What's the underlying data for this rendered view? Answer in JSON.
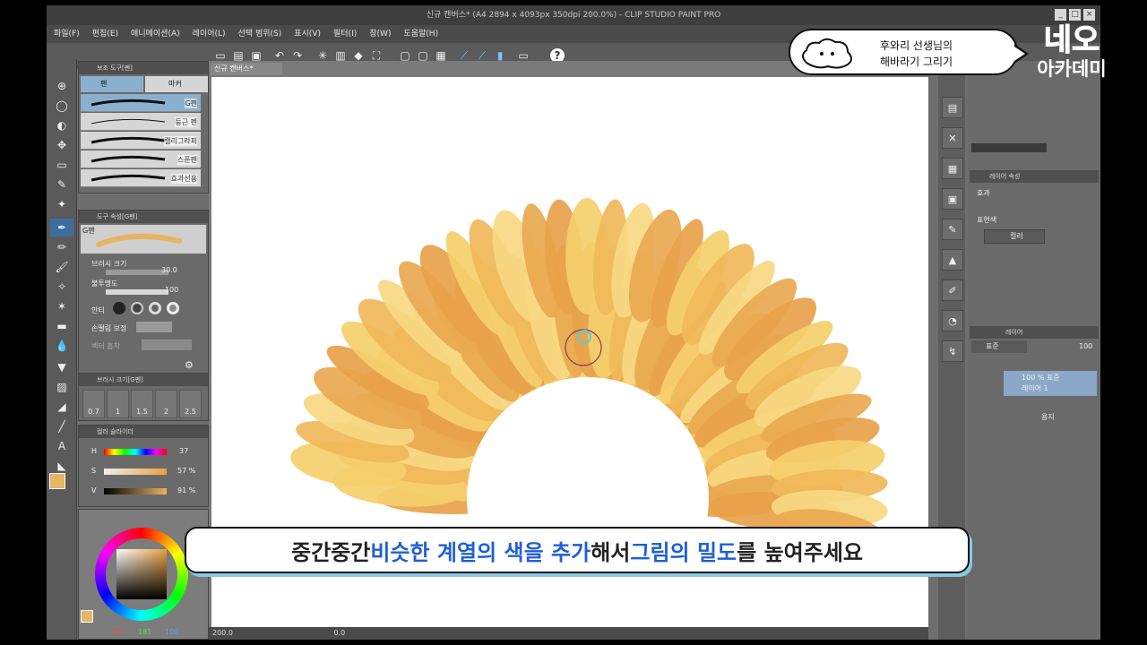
{
  "window": {
    "title": "신규 캔버스* (A4 2894 x 4093px 350dpi 200.0%) - CLIP STUDIO PAINT PRO",
    "controls": [
      "_",
      "□",
      "×"
    ]
  },
  "menu": {
    "items": [
      "파일(F)",
      "편집(E)",
      "애니메이션(A)",
      "레이어(L)",
      "선택 범위(S)",
      "표시(V)",
      "필터(I)",
      "창(W)",
      "도움말(H)"
    ]
  },
  "subtool_panel": {
    "title": "보조 도구[펜]",
    "tabs": [
      "펜",
      "마커"
    ],
    "brushes": [
      "G펜",
      "둥근 펜",
      "캘리그라피",
      "스푼펜",
      "효과선용"
    ]
  },
  "tool_property": {
    "title": "도구 속성[G펜]",
    "name": "G펜",
    "brush_size_label": "브러시 크기",
    "brush_size_value": "30.0",
    "opacity_label": "불투명도",
    "opacity_value": "100",
    "antialias_label": "안티",
    "stabilization_label": "손떨림 보정",
    "vector_label": "벡터 흡착"
  },
  "brush_size_panel": {
    "title": "브러시 크기[G펜]",
    "sizes": [
      "0.7",
      "1",
      "1.5",
      "2",
      "2.5"
    ]
  },
  "color_slider": {
    "title": "컬러 슬라이더",
    "h_label": "H",
    "h_value": "37",
    "s_label": "S",
    "s_value": "57 %",
    "v_label": "V",
    "v_value": "91 %"
  },
  "color_circle": {
    "r": "231",
    "g": "181",
    "b": "100"
  },
  "canvas": {
    "tab_label": "신규 캔버스*",
    "zoom": "200.0",
    "angle": "0.0"
  },
  "layer_property": {
    "title": "레이어 속성",
    "effect_label": "효과",
    "expression_label": "표현색",
    "expression_value": "컬러"
  },
  "layer_panel": {
    "title": "레이어",
    "blend_mode": "표준",
    "opacity": "100",
    "layers": [
      {
        "line1": "100 %  표준",
        "line2": "레이어 1"
      },
      {
        "line1": "",
        "line2": "용지"
      }
    ]
  },
  "overlay": {
    "speech_line1": "후와리 선생님의",
    "speech_line2": "해바라기 그리기",
    "brand_line1": "네오",
    "brand_line2": "아카데미",
    "caption_parts": [
      "중간중간 ",
      "비슷한 계열의 색을 추가",
      "해서 ",
      "그림의 밀도",
      "를 높여주세요"
    ]
  },
  "colors": {
    "petal_orange": "#e8a24a",
    "petal_yellow": "#f4cf6b",
    "current_color": "#e7b564",
    "accent_blue": "#1f5fd6"
  }
}
